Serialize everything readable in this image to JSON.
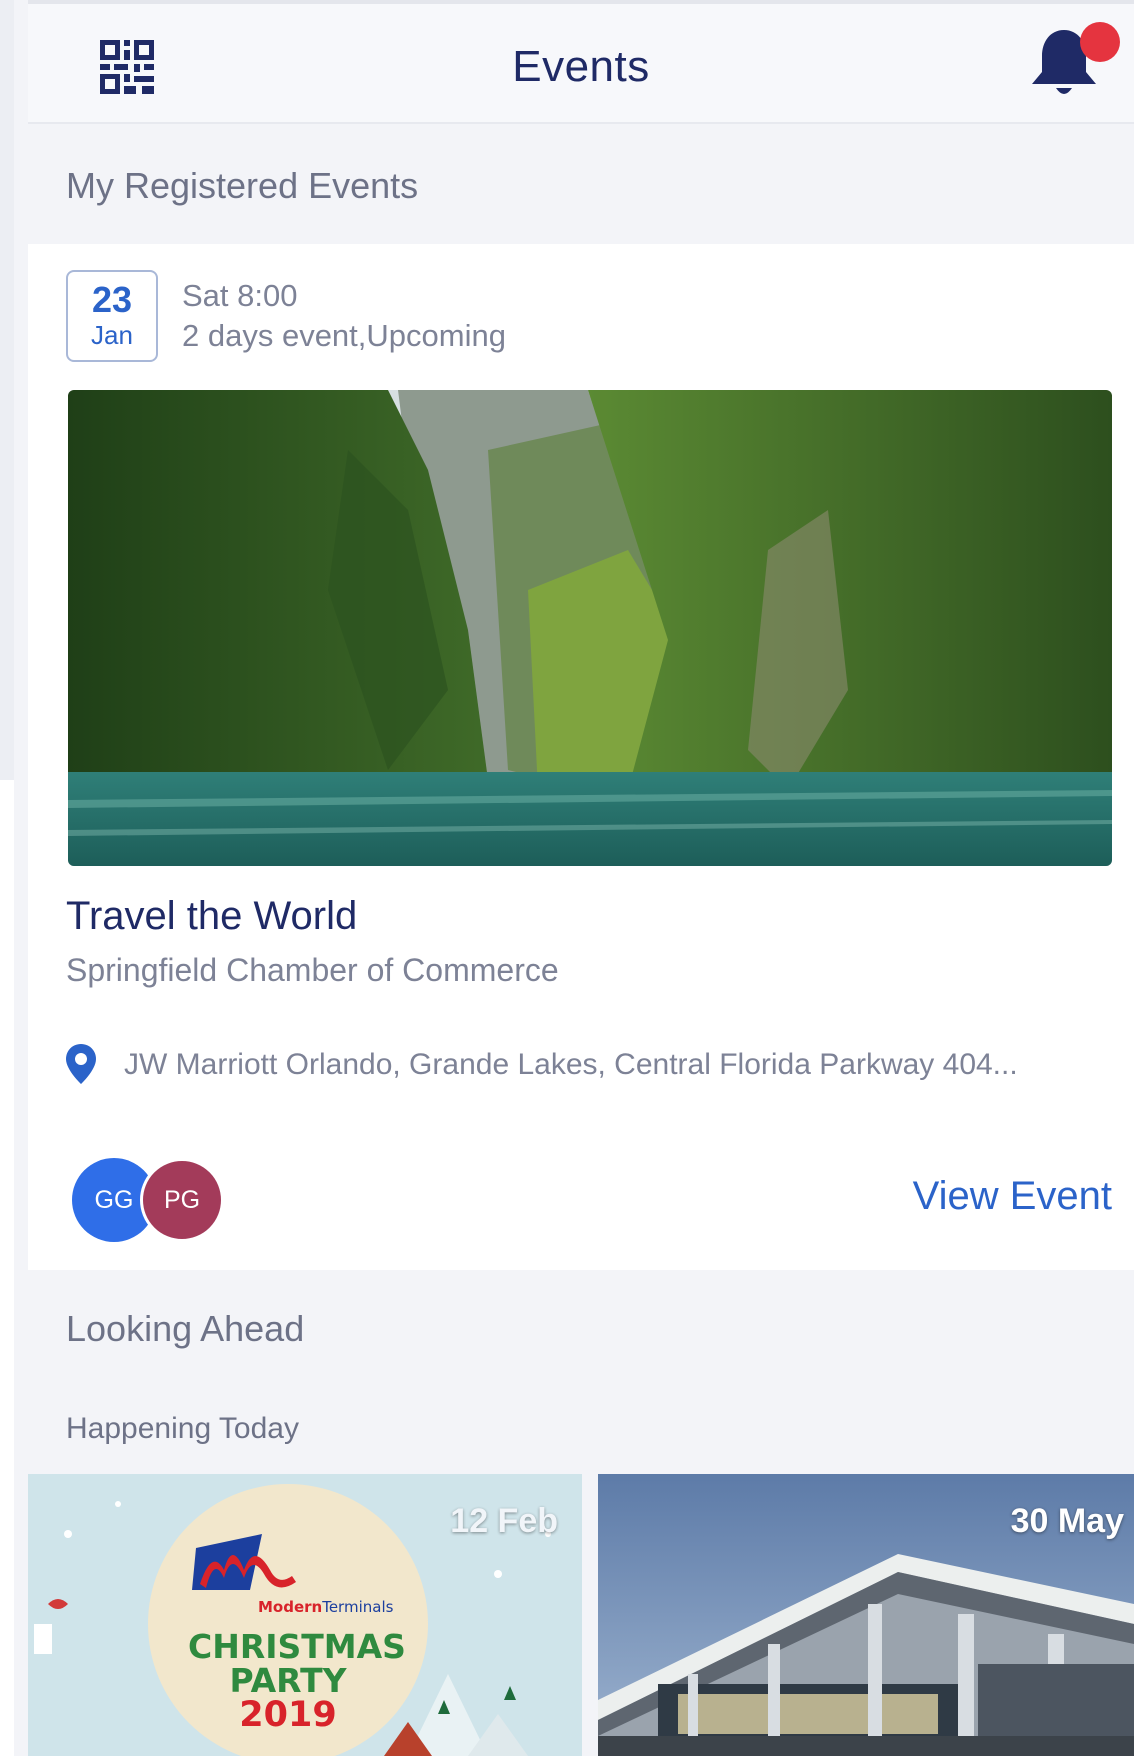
{
  "header": {
    "title": "Events",
    "notification": {
      "has_unread": true,
      "dot_color": "#e5343f"
    }
  },
  "registered": {
    "section_label": "My Registered Events",
    "event": {
      "date_day": "23",
      "date_month": "Jan",
      "time": "Sat 8:00",
      "description": "2 days event,Upcoming",
      "name": "Travel the World",
      "organizer": "Springfield Chamber of Commerce",
      "address": "JW Marriott Orlando, Grande Lakes, Central Florida Parkway 404...",
      "attendees": [
        {
          "initials": "GG",
          "color": "#2f6ee8"
        },
        {
          "initials": "PG",
          "color": "#a33b5a"
        }
      ],
      "view_label": "View Event"
    }
  },
  "looking_ahead": {
    "section_label": "Looking Ahead",
    "subsection_label": "Happening Today",
    "events": [
      {
        "date": "12 Feb",
        "poster": {
          "brand_line1": "Modern",
          "brand_line2": "Terminals",
          "line1": "CHRISTMAS",
          "line2": "PARTY",
          "line3": "2019"
        }
      },
      {
        "date": "30 May"
      }
    ]
  },
  "colors": {
    "accent": "#2b63c9",
    "navy": "#1f2a66",
    "muted": "#7d8296"
  }
}
